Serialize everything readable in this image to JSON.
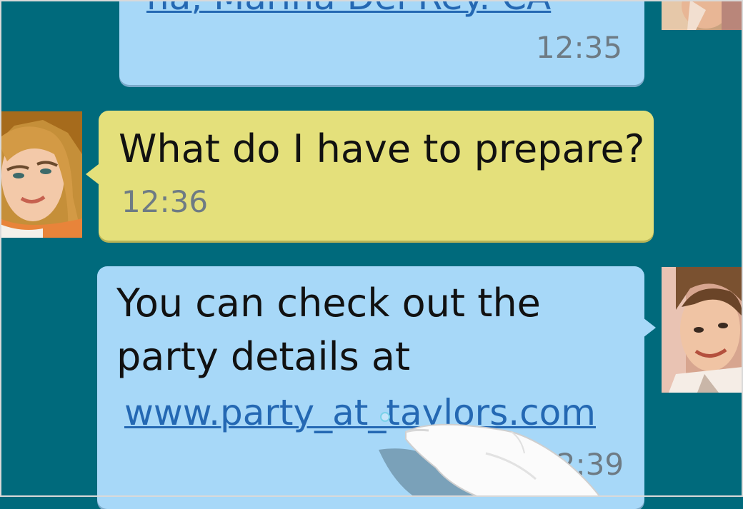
{
  "messages": [
    {
      "id": "msg-1",
      "direction": "outgoing",
      "link": "na, Marina Del Rey. CA",
      "time": "12:35"
    },
    {
      "id": "msg-2",
      "direction": "incoming",
      "text": "What do I have to prepare?",
      "time": "12:36"
    },
    {
      "id": "msg-3",
      "direction": "outgoing",
      "text_line_1": "You can check out the",
      "text_line_2": "party details at",
      "link": "www.party_at_taylors.com",
      "time": "12:39"
    }
  ],
  "colors": {
    "background": "#006a7c",
    "outgoing_bubble": "#a7d8f8",
    "incoming_bubble": "#e4e07b",
    "link": "#2468b3",
    "timestamp": "#6e7b84"
  },
  "avatars": {
    "incoming": "avatar-girl",
    "outgoing": "avatar-boy"
  },
  "touch_indicator": "finger-tap-icon"
}
